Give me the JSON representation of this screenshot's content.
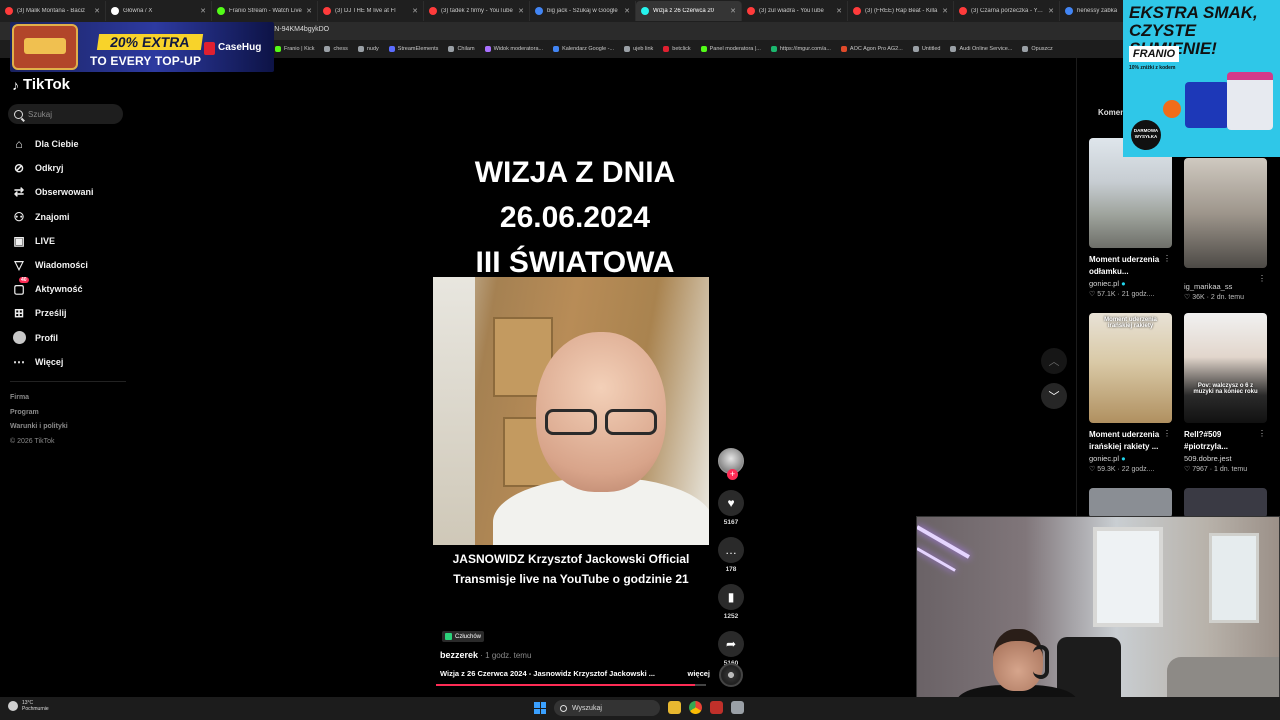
{
  "browser": {
    "tabs": [
      {
        "label": "(3) Malik Montana - Baciz",
        "color": "#ff3b3b"
      },
      {
        "label": "Główna / X",
        "color": "#ffffff"
      },
      {
        "label": "Franio Stream - Watch Live",
        "color": "#53fc18"
      },
      {
        "label": "(3) DJ THE M live at Fl",
        "color": "#ff3b3b"
      },
      {
        "label": "(3) tadek z firmy - YouTube",
        "color": "#ff3b3b"
      },
      {
        "label": "big jack - Szukaj w Google",
        "color": "#4285f4"
      },
      {
        "label": "Wizja z 26 Czerwca 20",
        "color": "#25f4ee",
        "active": true
      },
      {
        "label": "(3) zul wiadra - YouTube",
        "color": "#ff3b3b"
      },
      {
        "label": "(3) (FREE) Rap Beat - Killa",
        "color": "#ff3b3b"
      },
      {
        "label": "(3) Czarna porzeczka - YouT",
        "color": "#ff3b3b"
      },
      {
        "label": "henessy zabka",
        "color": "#4285f4"
      }
    ],
    "url_tail": "ZN-94KM4bgykDO",
    "bookmarks": [
      {
        "label": "Franio | Kick",
        "color": "#53fc18"
      },
      {
        "label": "chess",
        "color": "#9aa0a6"
      },
      {
        "label": "nudy",
        "color": "#9aa0a6"
      },
      {
        "label": "StreamElements",
        "color": "#5b6cff"
      },
      {
        "label": "Chilam",
        "color": "#9aa0a6"
      },
      {
        "label": "Widok moderatora...",
        "color": "#a970ff"
      },
      {
        "label": "Kalendarz Google -...",
        "color": "#4285f4"
      },
      {
        "label": "ujeb link",
        "color": "#9aa0a6"
      },
      {
        "label": "betclick",
        "color": "#e02030"
      },
      {
        "label": "Panel moderatora |...",
        "color": "#53fc18"
      },
      {
        "label": "https://imgur.com/a...",
        "color": "#1bb76e"
      },
      {
        "label": "AOC Agon Pro AG2...",
        "color": "#e04a2a"
      },
      {
        "label": "Untitled",
        "color": "#9aa0a6"
      },
      {
        "label": "Audi Online Service...",
        "color": "#9aa0a6"
      },
      {
        "label": "Opuszcz",
        "color": "#9aa0a6"
      }
    ]
  },
  "ad_left": {
    "headline": "20% EXTRA",
    "sub": "TO EVERY TOP-UP",
    "brand": "CaseHug"
  },
  "ad_right": {
    "headline": "EKSTRA SMAK, CZYSTE SUMIENIE!",
    "brand": "FRANIO",
    "small": "10% zniżki z kodem",
    "stamp": "DARMOWA WYSYŁKA"
  },
  "sidebar": {
    "logo": "TikTok",
    "search_placeholder": "Szukaj",
    "items": [
      {
        "label": "Dla Ciebie",
        "icon": "home-icon",
        "glyph": "⌂"
      },
      {
        "label": "Odkryj",
        "icon": "compass-icon",
        "glyph": "⊘"
      },
      {
        "label": "Obserwowani",
        "icon": "following-icon",
        "glyph": "⇄"
      },
      {
        "label": "Znajomi",
        "icon": "friends-icon",
        "glyph": "⚇"
      },
      {
        "label": "LIVE",
        "icon": "live-icon",
        "glyph": "▣"
      },
      {
        "label": "Wiadomości",
        "icon": "messages-icon",
        "glyph": "▽"
      },
      {
        "label": "Aktywność",
        "icon": "activity-icon",
        "glyph": "▢",
        "badge": "40"
      },
      {
        "label": "Prześlij",
        "icon": "upload-icon",
        "glyph": "⊞"
      },
      {
        "label": "Profil",
        "icon": "profile-icon",
        "glyph": ""
      },
      {
        "label": "Więcej",
        "icon": "more-icon",
        "glyph": "⋯"
      }
    ],
    "footer": [
      "Firma",
      "Program",
      "Warunki i polityki"
    ],
    "copyright": "© 2026 TikTok"
  },
  "video": {
    "headline": [
      "WIZJA Z DNIA",
      "26.06.2024",
      "III ŚWIATOWA"
    ],
    "caption": [
      "JASNOWIDZ Krzysztof Jackowski Official",
      "Transmisje live na YouTube o godzinie 21"
    ],
    "sound": "Człuchów",
    "author": "bezzerek",
    "time": " · 1 godz. temu",
    "description": "Wizja z 26 Czerwca 2024 - Jasnowidz Krzysztof Jackowski ...",
    "more": "więcej",
    "progress": 0.96,
    "likes": "5167",
    "comments": "178",
    "saves": "1252",
    "shares": "5160"
  },
  "right_pane": {
    "tab": "Komen",
    "cards": [
      {
        "title": [
          "Moment uderzenia",
          "odłamku..."
        ],
        "author": "goniec.pl",
        "verified": true,
        "meta": "♡ 57.1K · 21 godz....",
        "overlay": ""
      },
      {
        "title": [],
        "author": "ig_marikaa_ss",
        "verified": false,
        "meta": "♡ 36K · 2 dn. temu",
        "overlay": ""
      },
      {
        "title": [
          "Moment uderzenia",
          "irańskiej rakiety ..."
        ],
        "author": "goniec.pl",
        "verified": true,
        "meta": "♡ 59.3K · 22 godz....",
        "overlay": "Moment uderzenia irańskiej rakiety"
      },
      {
        "title": [
          "Rell?#509",
          "#piotrzyla..."
        ],
        "author": "509.dobre.jest",
        "verified": false,
        "meta": "♡ 7967 · 1 dn. temu",
        "overlay": "Pov: walczysz o 6 z muzyki na koniec roku"
      }
    ]
  },
  "taskbar": {
    "temp": "13°C",
    "weather": "Pochmurnie",
    "search": "Wyszukaj"
  }
}
